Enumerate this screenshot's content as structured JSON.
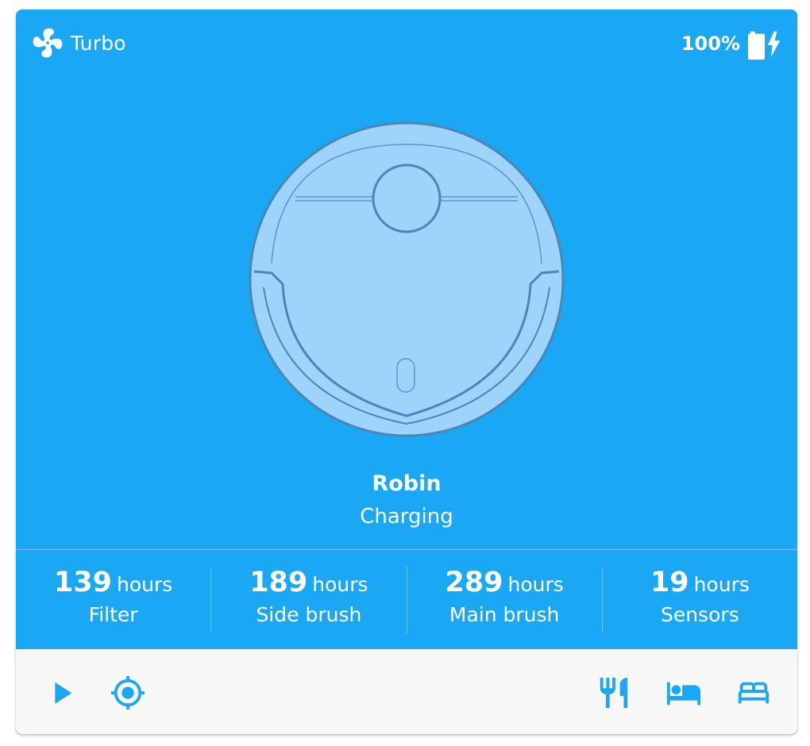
{
  "header": {
    "mode_icon": "fan-icon",
    "mode_label": "Turbo",
    "battery_label": "100%",
    "battery_icon": "battery-charging-icon"
  },
  "robot": {
    "name": "Robin",
    "status": "Charging"
  },
  "stats": [
    {
      "value": "139",
      "unit": "hours",
      "label": "Filter"
    },
    {
      "value": "189",
      "unit": "hours",
      "label": "Side brush"
    },
    {
      "value": "289",
      "unit": "hours",
      "label": "Main brush"
    },
    {
      "value": "19",
      "unit": "hours",
      "label": "Sensors"
    }
  ],
  "toolbar": {
    "left": [
      "play-icon",
      "locate-icon"
    ],
    "right": [
      "kitchen-icon",
      "bed-icon",
      "sofa-icon"
    ]
  },
  "colors": {
    "accent": "#1aa7f4",
    "robot_body": "#9fd4fa",
    "robot_outline": "#4a86b8",
    "toolbar_bg": "#f7f7f7"
  }
}
